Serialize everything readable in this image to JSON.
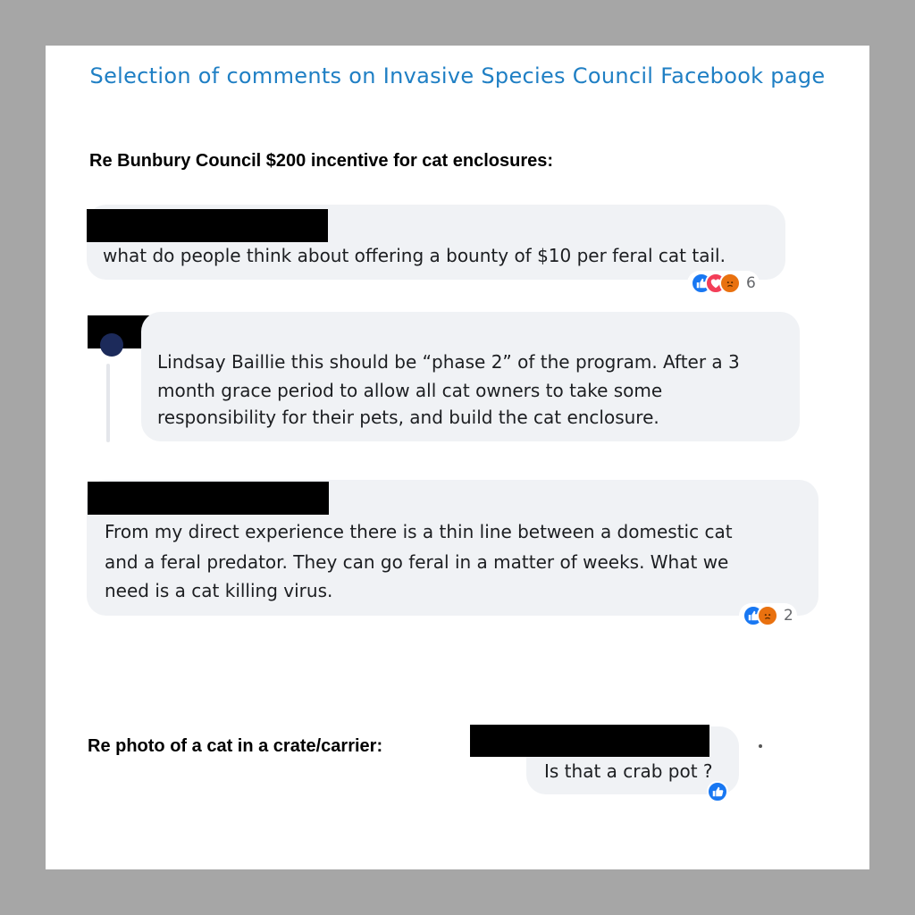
{
  "header": {
    "title": "Selection of comments on Invasive Species Council Facebook page"
  },
  "sections": [
    {
      "label": "Re Bunbury Council $200 incentive for cat enclosures:",
      "comments": [
        {
          "text": "what do people think about offering a bounty of $10 per feral cat tail.",
          "reactions": [
            "like-icon",
            "love-icon",
            "angry-icon"
          ],
          "reaction_count": "6"
        },
        {
          "text_lines": [
            "Lindsay Baillie this should be “phase 2” of the program. After a 3",
            "month grace period to allow all cat owners to take some",
            "responsibility for their pets, and build the cat enclosure."
          ]
        },
        {
          "text_lines": [
            "From my direct experience there is a thin line between a domestic cat",
            "and a feral predator. They can go feral in a matter of weeks. What we",
            "need is a cat killing virus."
          ],
          "reactions": [
            "like-icon",
            "angry-icon"
          ],
          "reaction_count": "2"
        }
      ]
    },
    {
      "label": "Re photo of a cat in  a crate/carrier:",
      "comments": [
        {
          "text": "Is that a crab pot ?",
          "reactions": [
            "like-icon"
          ]
        }
      ]
    }
  ],
  "colors": {
    "background": "#a6a6a6",
    "panel": "#ffffff",
    "title": "#1f7fc4",
    "bubble": "#f0f2f5",
    "like": "#1877f2",
    "love": "#f33e58",
    "angry": "#e9710f"
  }
}
